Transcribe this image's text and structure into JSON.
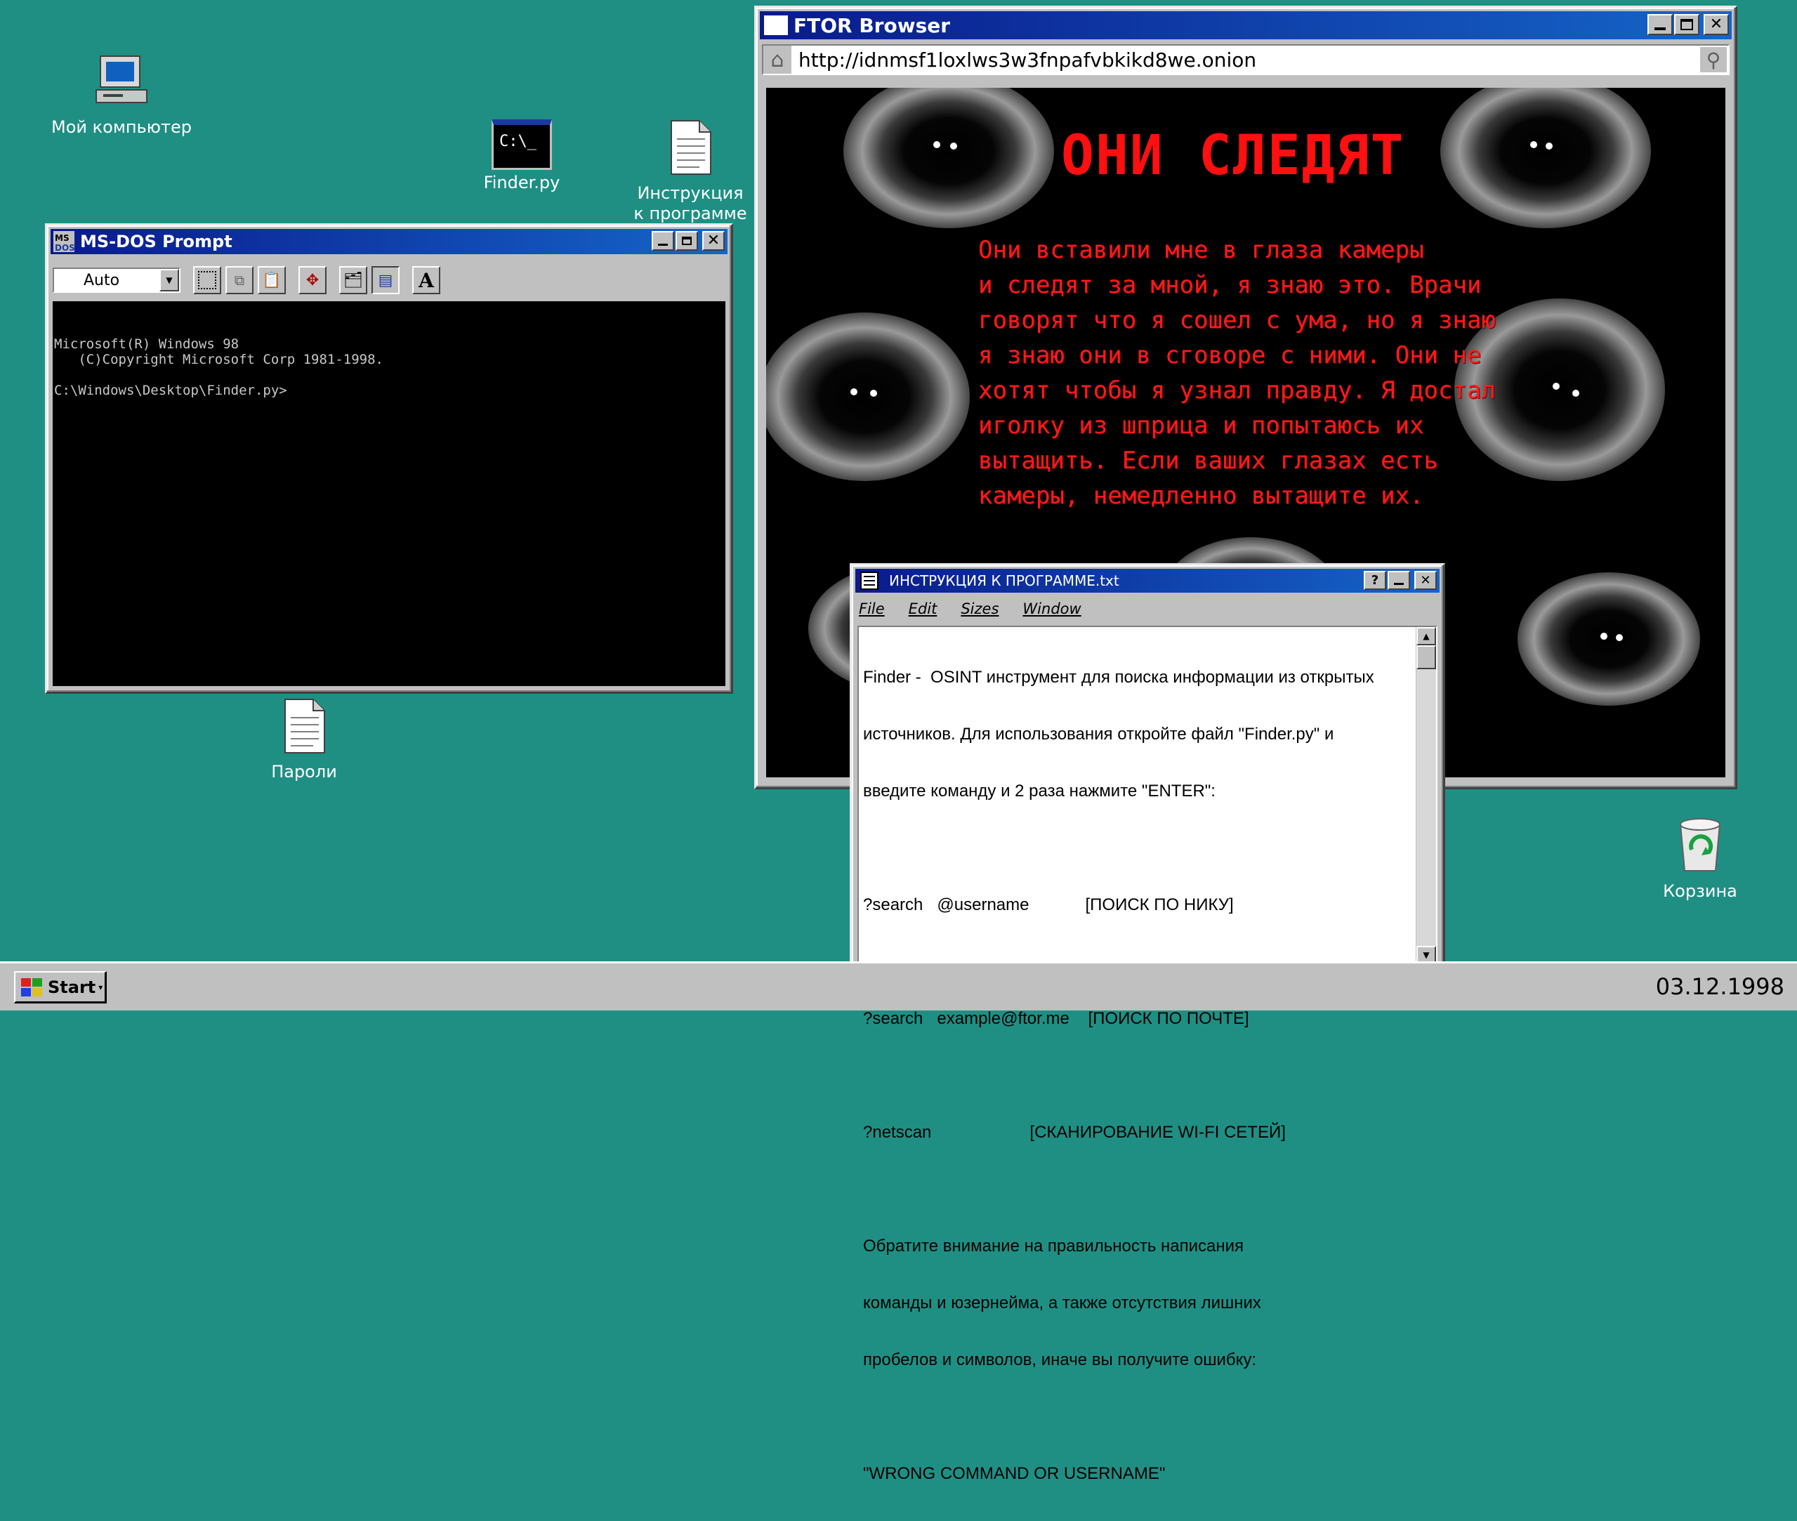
{
  "desktop": {
    "icons": [
      {
        "label": "Мой компьютер",
        "icon": "my-computer-icon"
      },
      {
        "label": "Finder.py",
        "icon": "dos-program-icon",
        "glyph": "C:\\_"
      },
      {
        "label": "Инструкция\nк программе",
        "icon": "text-document-icon"
      },
      {
        "label": "Пароли",
        "icon": "text-document-icon"
      },
      {
        "label": "Корзина",
        "icon": "recycle-bin-icon"
      }
    ]
  },
  "dos": {
    "title": "MS-DOS Prompt",
    "font_size": "Auto",
    "toolbar_letter": "A",
    "lines": "Microsoft(R) Windows 98\n   (C)Copyright Microsoft Corp 1981-1998.\n\nC:\\Windows\\Desktop\\Finder.py>"
  },
  "browser": {
    "title": "FTOR Browser",
    "url": "http://idnmsf1loxlws3w3fnpafvbkikd8we.onion",
    "headline": "ОНИ СЛЕДЯТ",
    "story": [
      "Они вставили мне в глаза камеры",
      "и следят за мной, я знаю это. Врачи",
      "говорят что я сошел с ума, но я знаю",
      "я знаю они в сговоре с ними. Они не",
      "хотят чтобы я узнал правду. Я достал",
      "иголку из шприца и попытаюсь их",
      "вытащить. Если ваших глазах есть",
      "камеры, немедленно вытащите их."
    ]
  },
  "notepad": {
    "title": "ИНСТРУКЦИЯ К ПРОГРАММЕ.txt",
    "menu": [
      "File",
      "Edit",
      "Sizes",
      "Window"
    ],
    "lines": [
      "Finder -  OSINT инструмент для поиска информации из открытых",
      "источников. Для использования откройте файл \"Finder.py\" и",
      "введите команду и 2 раза нажмите \"ENTER\":",
      "",
      "?search   @username            [ПОИСК ПО НИКУ]",
      "",
      "?search   example@ftor.me    [ПОИСК ПО ПОЧТЕ]",
      "",
      "?netscan                     [СКАНИРОВАНИЕ WI-FI СЕТЕЙ]",
      "",
      "Обратите внимание на правильность написания",
      "команды и юзернейма, а также отсутствия лишних",
      "пробелов и символов, иначе вы получите ошибку:",
      "",
      "\"WRONG COMMAND OR USERNAME\""
    ]
  },
  "taskbar": {
    "start_label": "Start",
    "date": "03.12.1998"
  },
  "colors": {
    "desktop": "#1f8f84",
    "titlebar": "#0a1a8c",
    "warning_text": "#ff1a1a"
  }
}
